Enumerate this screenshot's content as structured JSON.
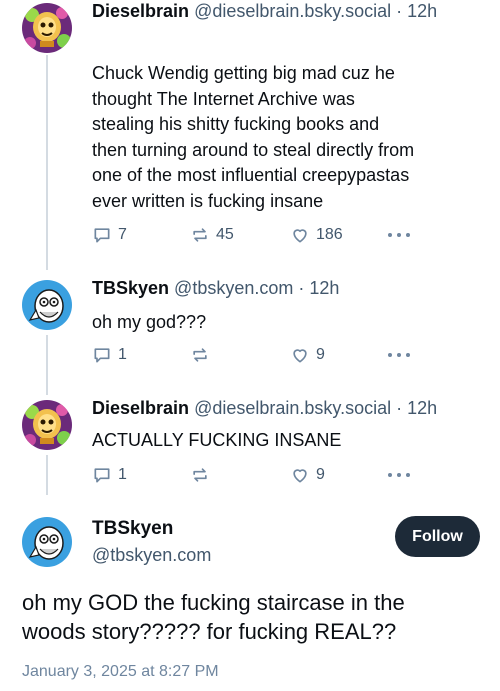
{
  "posts": [
    {
      "author_name": "Dieselbrain",
      "handle_time": "@dieselbrain.bsky.social · 12h",
      "text_lines": [
        "Chuck Wendig getting big mad cuz he",
        "thought The Internet Archive was",
        "stealing his shitty fucking books and",
        "then turning around to steal directly from",
        "one of the most influential creepypastas",
        "ever written is fucking insane"
      ],
      "replies": "7",
      "reposts": "45",
      "likes": "186"
    },
    {
      "author_name": "TBSkyen",
      "handle_time": "@tbskyen.com · 12h",
      "text_lines": [
        "oh my god???"
      ],
      "replies": "1",
      "reposts": "",
      "likes": "9"
    },
    {
      "author_name": "Dieselbrain",
      "handle_time": "@dieselbrain.bsky.social · 12h",
      "text_lines": [
        "ACTUALLY FUCKING INSANE"
      ],
      "replies": "1",
      "reposts": "",
      "likes": "9"
    }
  ],
  "main_post": {
    "author_name": "TBSkyen",
    "handle": "@tbskyen.com",
    "follow_label": "Follow",
    "text_lines": [
      "oh my GOD the fucking staircase in the",
      "woods story????? for fucking REAL??"
    ],
    "date": "January 3, 2025 at 8:27 PM"
  },
  "icons": {
    "reply": "speech-bubble-icon",
    "repost": "repost-arrows-icon",
    "like": "heart-icon",
    "more": "ellipsis-icon"
  },
  "colors": {
    "text": "#0b0f14",
    "muted": "#42576c",
    "icon": "#6f869f",
    "follow_bg": "#1d2a38",
    "thread_line": "#d4dbe2"
  }
}
